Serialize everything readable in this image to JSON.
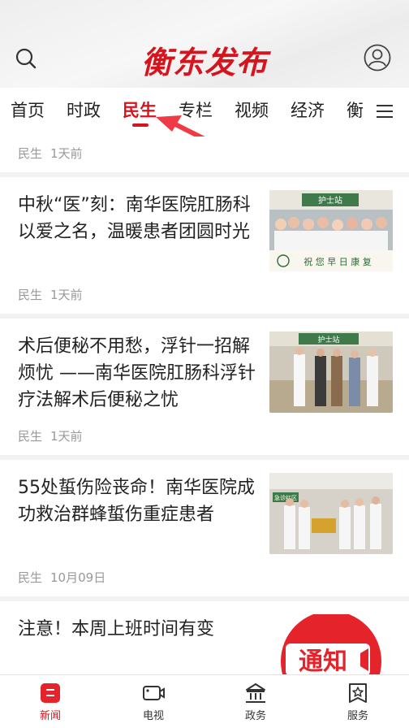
{
  "header": {
    "logo_text": "衡东发布",
    "brand_color": "#d6141e"
  },
  "tabs": [
    {
      "label": "首页"
    },
    {
      "label": "时政"
    },
    {
      "label": "民生"
    },
    {
      "label": "专栏"
    },
    {
      "label": "视频"
    },
    {
      "label": "经济"
    },
    {
      "label": "衡"
    }
  ],
  "active_tab": "民生",
  "partial_item": {
    "category": "民生",
    "time": "1天前"
  },
  "articles": [
    {
      "title": "中秋“医”刻：南华医院肛肠科以爱之名，温暖患者团圆时光",
      "category": "民生",
      "time": "1天前",
      "thumb_caption": "祝 您 早 日 康 复",
      "thumb_sign": "护士站"
    },
    {
      "title": "术后便秘不用愁，浮针一招解烦忧 ——南华医院肛肠科浮针疗法解术后便秘之忧",
      "category": "民生",
      "time": "1天前",
      "thumb_sign": "护士站"
    },
    {
      "title": "55处蜇伤险丧命！南华医院成功救治群蜂蜇伤重症患者",
      "category": "民生",
      "time": "10月09日",
      "thumb_sign": "急诊红区"
    },
    {
      "title": "注意！本周上班时间有变",
      "thumb_text": "通知"
    }
  ],
  "bottom_nav": [
    {
      "label": "新闻",
      "icon": "news-icon"
    },
    {
      "label": "电视",
      "icon": "tv-icon"
    },
    {
      "label": "政务",
      "icon": "government-icon"
    },
    {
      "label": "服务",
      "icon": "service-icon"
    }
  ]
}
